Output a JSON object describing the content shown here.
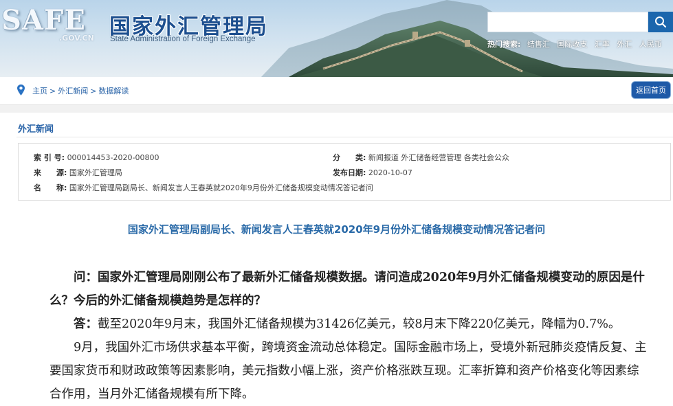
{
  "header": {
    "logo_text": "SAFE",
    "logo_domain": ".GOV.CN",
    "site_title": "国家外汇管理局",
    "site_subtitle": "State Administration of Foreign Exchange",
    "search_placeholder": "",
    "search_icon": "search-icon",
    "hot_search_label": "热门搜索:",
    "hot_search_items": [
      "结售汇",
      "国际收支",
      "汇率",
      "外汇",
      "人民币"
    ],
    "brand_color": "#1d4f8f"
  },
  "breadcrumb": {
    "icon": "location-pin-icon",
    "items": [
      "主页",
      "外汇新闻",
      "数据解读"
    ],
    "separator": ">",
    "back_button": "返回首页"
  },
  "section": {
    "title": "外汇新闻"
  },
  "meta": {
    "index_label": "索 引 号:",
    "index_value": "000014453-2020-00800",
    "category_label": "分　　类:",
    "category_value": "新闻报道  外汇储备经营管理  各类社会公众",
    "source_label": "来　　源:",
    "source_value": "国家外汇管理局",
    "date_label": "发布日期:",
    "date_value": "2020-10-07",
    "name_label": "名　　称:",
    "name_value": "国家外汇管理局副局长、新闻发言人王春英就2020年9月份外汇储备规模变动情况答记者问"
  },
  "article": {
    "title": "国家外汇管理局副局长、新闻发言人王春英就2020年9月份外汇储备规模变动情况答记者问",
    "question": "问：国家外汇管理局刚刚公布了最新外汇储备规模数据。请问造成2020年9月外汇储备规模变动的原因是什么？今后的外汇储备规模趋势是怎样的？",
    "answer_label": "答：",
    "answer": "截至2020年9月末，我国外汇储备规模为31426亿美元，较8月末下降220亿美元，降幅为0.7%。",
    "para2": "9月，我国外汇市场供求基本平衡，跨境资金流动总体稳定。国际金融市场上，受境外新冠肺炎疫情反复、主要国家货币和财政政策等因素影响，美元指数小幅上涨，资产价格涨跌互现。汇率折算和资产价格变化等因素综合作用，当月外汇储备规模有所下降。"
  }
}
